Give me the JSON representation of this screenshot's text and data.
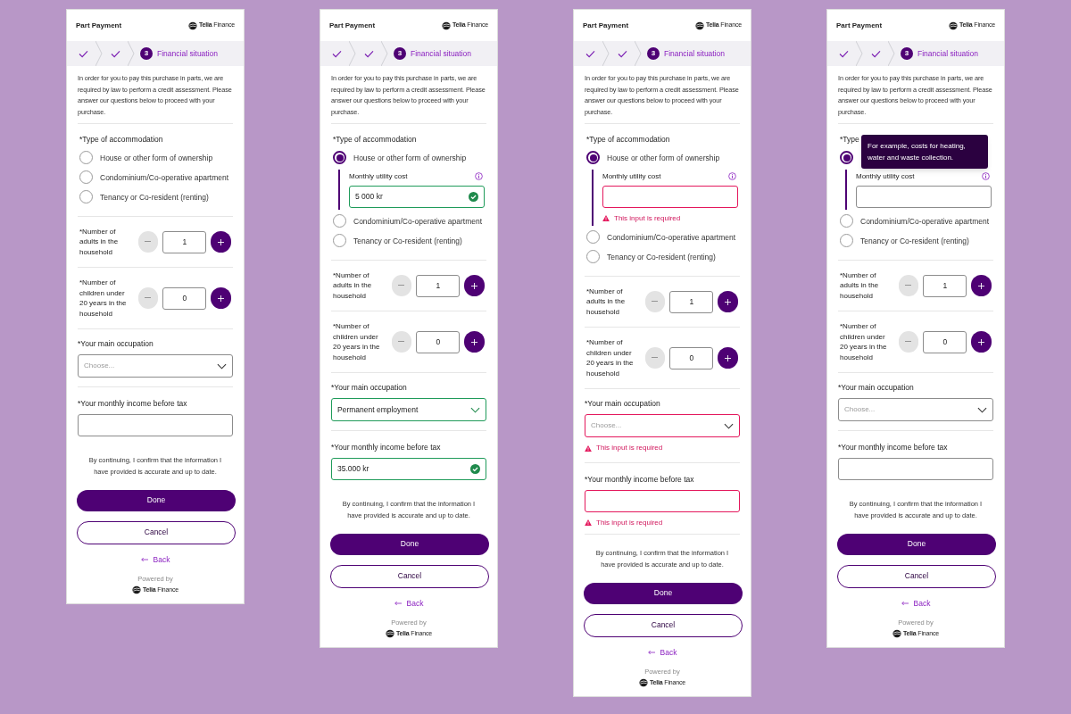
{
  "panels": [
    {
      "header": {
        "title": "Part Payment",
        "brand": "**Telia** Finance"
      },
      "steps": [
        {
          "kind": "done"
        },
        {
          "kind": "done"
        },
        {
          "kind": "current",
          "number": "3",
          "label": "Financial situation"
        }
      ],
      "intro": "In order for you to pay this purchase in parts, we are required by law to perform a credit assessment. Please answer our questions below to proceed with your purchase.",
      "accommodation": {
        "label": "*Type of accommodation",
        "options": [
          {
            "label": "House or other form of ownership",
            "selected": false
          },
          {
            "label": "Condominium/Co-operative apartment",
            "selected": false
          },
          {
            "label": "Tenancy or Co-resident (renting)",
            "selected": false
          }
        ]
      },
      "counters": [
        {
          "label": "*Number of adults in the household",
          "value": "1"
        },
        {
          "label": "*Number of children under 20 years in the household",
          "value": "0"
        }
      ],
      "occupation": {
        "label": "*Your main occupation",
        "placeholder": "Choose...",
        "valid": false,
        "invalid": false
      },
      "income": {
        "label": "*Your monthly income before tax",
        "valid": false,
        "invalid": false
      },
      "confirm": "By continuing, I confirm that the information I have provided is accurate and up to date.",
      "done": "Done",
      "cancel": "Cancel",
      "back": "Back",
      "powered_by": "Powered by",
      "footer_brand": "**Telia** Finance"
    },
    {
      "header": {
        "title": "Part Payment",
        "brand": "**Telia** Finance"
      },
      "steps": [
        {
          "kind": "done"
        },
        {
          "kind": "done"
        },
        {
          "kind": "current",
          "number": "3",
          "label": "Financial situation"
        }
      ],
      "intro": "In order for you to pay this purchase in parts, we are required by law to perform a credit assessment. Please answer our questions below to proceed with your purchase.",
      "accommodation": {
        "label": "*Type of accommodation",
        "options": [
          {
            "label": "House or other form of ownership",
            "selected": true,
            "utility": {
              "label": "Monthly utility cost",
              "value": "5 000 kr",
              "valid": true,
              "invalid": false
            }
          },
          {
            "label": "Condominium/Co-operative apartment",
            "selected": false
          },
          {
            "label": "Tenancy or Co-resident (renting)",
            "selected": false
          }
        ]
      },
      "counters": [
        {
          "label": "*Number of adults in the household",
          "value": "1"
        },
        {
          "label": "*Number of children under 20 years in the household",
          "value": "0"
        }
      ],
      "occupation": {
        "label": "*Your main occupation",
        "value": "Permanent employment",
        "valid": true,
        "invalid": false
      },
      "income": {
        "label": "*Your monthly income before tax",
        "value": "35.000 kr",
        "valid": true,
        "invalid": false
      },
      "confirm": "By continuing, I confirm that the information I have provided is accurate and up to date.",
      "done": "Done",
      "cancel": "Cancel",
      "back": "Back",
      "powered_by": "Powered by",
      "footer_brand": "**Telia** Finance"
    },
    {
      "header": {
        "title": "Part Payment",
        "brand": "**Telia** Finance"
      },
      "steps": [
        {
          "kind": "done"
        },
        {
          "kind": "done"
        },
        {
          "kind": "current",
          "number": "3",
          "label": "Financial situation"
        }
      ],
      "intro": "In order for you to pay this purchase in parts, we are required by law to perform a credit assessment. Please answer our questions below to proceed with your purchase.",
      "accommodation": {
        "label": "*Type of accommodation",
        "options": [
          {
            "label": "House or other form of ownership",
            "selected": true,
            "utility": {
              "label": "Monthly utility cost",
              "valid": false,
              "invalid": true,
              "error": "This input is required"
            }
          },
          {
            "label": "Condominium/Co-operative apartment",
            "selected": false
          },
          {
            "label": "Tenancy or Co-resident (renting)",
            "selected": false
          }
        ]
      },
      "counters": [
        {
          "label": "*Number of adults in the household",
          "value": "1"
        },
        {
          "label": "*Number of children under 20 years in the household",
          "value": "0"
        }
      ],
      "occupation": {
        "label": "*Your main occupation",
        "placeholder": "Choose...",
        "valid": false,
        "invalid": true,
        "error": "This input is required"
      },
      "income": {
        "label": "*Your monthly income before tax",
        "valid": false,
        "invalid": true,
        "error": "This input is required"
      },
      "confirm": "By continuing, I confirm that the information I have provided is accurate and up to date.",
      "done": "Done",
      "cancel": "Cancel",
      "back": "Back",
      "powered_by": "Powered by",
      "footer_brand": "**Telia** Finance"
    },
    {
      "header": {
        "title": "Part Payment",
        "brand": "**Telia** Finance"
      },
      "steps": [
        {
          "kind": "done"
        },
        {
          "kind": "done"
        },
        {
          "kind": "current",
          "number": "3",
          "label": "Financial situation"
        }
      ],
      "intro": "In order for you to pay this purchase in parts, we are required by law to perform a credit assessment. Please answer our questions below to proceed with your purchase.",
      "accommodation": {
        "label": "*Type",
        "options": [
          {
            "selected": true,
            "utility": {
              "label": "Monthly utility cost",
              "valid": false,
              "invalid": false,
              "tooltip": "For example, costs for heating, water and waste collection."
            }
          },
          {
            "label": "Condominium/Co-operative apartment",
            "selected": false
          },
          {
            "label": "Tenancy or Co-resident (renting)",
            "selected": false
          }
        ]
      },
      "counters": [
        {
          "label": "*Number of adults in the household",
          "value": "1"
        },
        {
          "label": "*Number of children under 20 years in the household",
          "value": "0"
        }
      ],
      "occupation": {
        "label": "*Your main occupation",
        "placeholder": "Choose...",
        "valid": false,
        "invalid": false
      },
      "income": {
        "label": "*Your monthly income before tax",
        "valid": false,
        "invalid": false
      },
      "confirm": "By continuing, I confirm that the information I have provided is accurate and up to date.",
      "done": "Done",
      "cancel": "Cancel",
      "back": "Back",
      "powered_by": "Powered by",
      "footer_brand": "**Telia** Finance"
    }
  ]
}
